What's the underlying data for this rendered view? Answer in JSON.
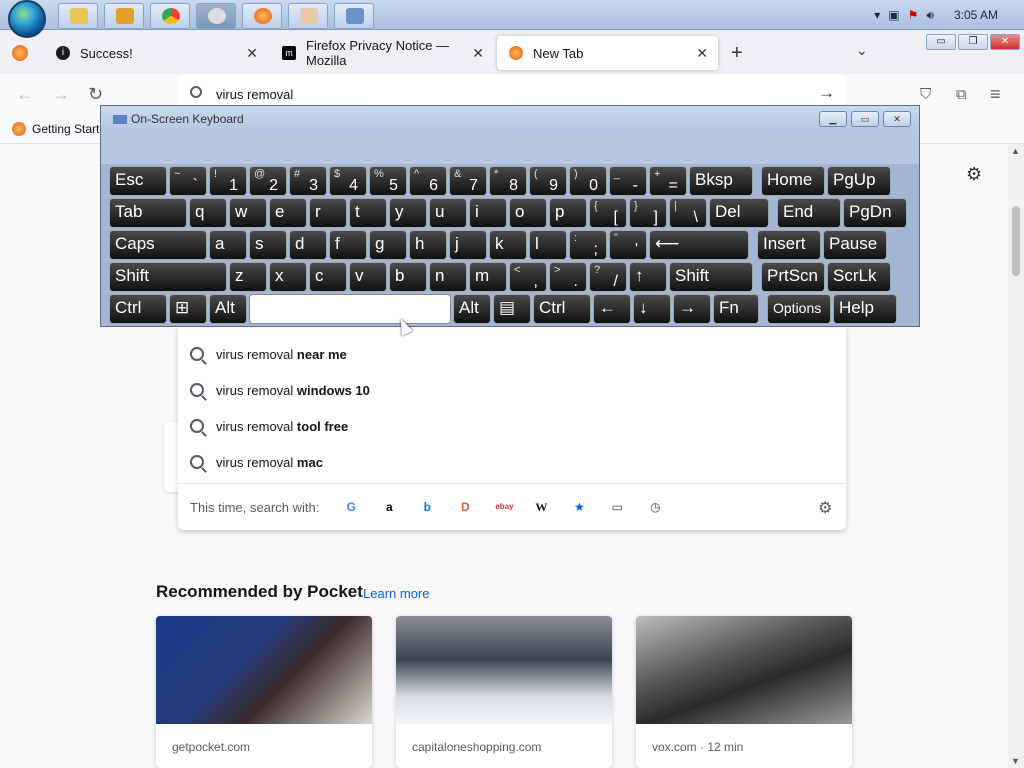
{
  "taskbar": {
    "clock": "3:05 AM"
  },
  "tabs": [
    {
      "label": "Success!"
    },
    {
      "label": "Firefox Privacy Notice — Mozilla"
    },
    {
      "label": "New Tab"
    }
  ],
  "urlbar": {
    "value": "virus removal"
  },
  "bookmarks": {
    "item": "Getting Started"
  },
  "osk": {
    "title": "On-Screen Keyboard",
    "rows": [
      [
        {
          "l": "Esc"
        },
        {
          "s": "~",
          "m": "`"
        },
        {
          "s": "!",
          "m": "1"
        },
        {
          "s": "@",
          "m": "2"
        },
        {
          "s": "#",
          "m": "3"
        },
        {
          "s": "$",
          "m": "4"
        },
        {
          "s": "%",
          "m": "5"
        },
        {
          "s": "^",
          "m": "6"
        },
        {
          "s": "&",
          "m": "7"
        },
        {
          "s": "*",
          "m": "8"
        },
        {
          "s": "(",
          "m": "9"
        },
        {
          "s": ")",
          "m": "0"
        },
        {
          "s": "_",
          "m": "-"
        },
        {
          "s": "+",
          "m": "="
        },
        {
          "l": "Bksp"
        },
        {
          "l": "Home"
        },
        {
          "l": "PgUp"
        }
      ],
      [
        {
          "l": "Tab"
        },
        {
          "l": "q"
        },
        {
          "l": "w"
        },
        {
          "l": "e"
        },
        {
          "l": "r"
        },
        {
          "l": "t"
        },
        {
          "l": "y"
        },
        {
          "l": "u"
        },
        {
          "l": "i"
        },
        {
          "l": "o"
        },
        {
          "l": "p"
        },
        {
          "s": "{",
          "m": "["
        },
        {
          "s": "}",
          "m": "]"
        },
        {
          "s": "|",
          "m": "\\"
        },
        {
          "l": "Del"
        },
        {
          "l": "End"
        },
        {
          "l": "PgDn"
        }
      ],
      [
        {
          "l": "Caps"
        },
        {
          "l": "a"
        },
        {
          "l": "s"
        },
        {
          "l": "d"
        },
        {
          "l": "f"
        },
        {
          "l": "g"
        },
        {
          "l": "h"
        },
        {
          "l": "j"
        },
        {
          "l": "k"
        },
        {
          "l": "l"
        },
        {
          "s": ":",
          "m": ";"
        },
        {
          "s": "\"",
          "m": "'"
        },
        {
          "l": "⟵"
        },
        {
          "l": "Insert"
        },
        {
          "l": "Pause"
        }
      ],
      [
        {
          "l": "Shift"
        },
        {
          "l": "z"
        },
        {
          "l": "x"
        },
        {
          "l": "c"
        },
        {
          "l": "v"
        },
        {
          "l": "b"
        },
        {
          "l": "n"
        },
        {
          "l": "m"
        },
        {
          "s": "<",
          "m": ","
        },
        {
          "s": ">",
          "m": "."
        },
        {
          "s": "?",
          "m": "/"
        },
        {
          "l": "↑"
        },
        {
          "l": "Shift"
        },
        {
          "l": "PrtScn"
        },
        {
          "l": "ScrLk"
        }
      ],
      [
        {
          "l": "Ctrl"
        },
        {
          "l": "⊞"
        },
        {
          "l": "Alt"
        },
        {
          "l": ""
        },
        {
          "l": "Alt"
        },
        {
          "l": "▤"
        },
        {
          "l": "Ctrl"
        },
        {
          "l": "←"
        },
        {
          "l": "↓"
        },
        {
          "l": "→"
        },
        {
          "l": "Fn"
        },
        {
          "l": "Options"
        },
        {
          "l": "Help"
        }
      ]
    ]
  },
  "suggestions": [
    {
      "base": "virus removal",
      "bold": "near me"
    },
    {
      "base": "virus removal",
      "bold": "windows 10"
    },
    {
      "base": "virus removal",
      "bold": "tool free"
    },
    {
      "base": "virus removal",
      "bold": "mac"
    }
  ],
  "search_with": {
    "label": "This time, search with:",
    "engines": [
      "G",
      "a",
      "b",
      "D",
      "ebay",
      "W",
      "★",
      "▭",
      "◷"
    ]
  },
  "pocket": {
    "title": "Recommended by Pocket",
    "learn_more": "Learn more",
    "cards": [
      {
        "source": "getpocket.com"
      },
      {
        "source": "capitaloneshopping.com"
      },
      {
        "source": "vox.com · 12 min"
      }
    ]
  }
}
